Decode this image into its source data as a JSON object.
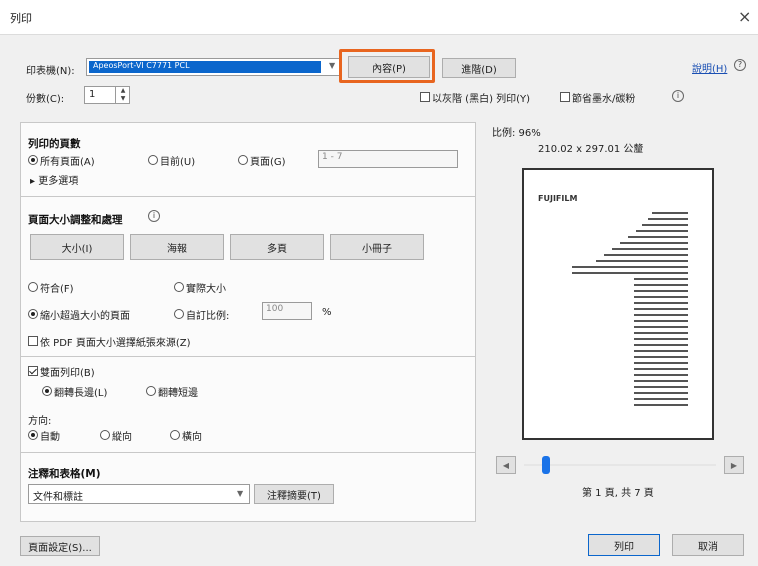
{
  "window": {
    "title": "列印",
    "close_glyph": "×"
  },
  "printer": {
    "label": "印表機(N):",
    "selected": "ApeosPort-VI C7771 PCL",
    "properties_label": "內容(P)",
    "advanced_label": "進階(D)",
    "help_link": "說明(H)",
    "highlight_color": "#e8651f"
  },
  "copies": {
    "label": "份數(C):",
    "value": "1",
    "grayscale_label": "以灰階 (黑白) 列印(Y)",
    "save_ink_label": "節省墨水/碳粉"
  },
  "pages": {
    "title": "列印的頁數",
    "options": [
      "所有頁面(A)",
      "目前(U)",
      "頁面(G)"
    ],
    "range_placeholder": "1 - 7",
    "more_options": "更多選項"
  },
  "sizing": {
    "title": "頁面大小調整和處理",
    "tabs": [
      "大小(I)",
      "海報",
      "多頁",
      "小冊子"
    ],
    "fit": "符合(F)",
    "actual_size": "實際大小",
    "shrink": "縮小超過大小的頁面",
    "custom_scale": "自訂比例:",
    "scale_value": "100",
    "percent": "%",
    "pdf_source": "依 PDF 頁面大小選擇紙張來源(Z)"
  },
  "duplex": {
    "label": "雙面列印(B)",
    "long_edge": "翻轉長邊(L)",
    "short_edge": "翻轉短邊"
  },
  "orientation": {
    "label": "方向:",
    "options": [
      "自動",
      "縱向",
      "橫向"
    ]
  },
  "comments": {
    "title": "注釋和表格(M)",
    "selected": "文件和標註",
    "summary_button": "注釋摘要(T)"
  },
  "preview": {
    "scale": "比例: 96%",
    "dimensions": "210.02 x 297.01 公釐",
    "brand": "FUJIFILM",
    "page_status": "第 1 頁, 共 7 頁",
    "current_page": 1,
    "total_pages": 7
  },
  "footer": {
    "page_setup": "頁面設定(S)...",
    "print": "列印",
    "cancel": "取消"
  }
}
